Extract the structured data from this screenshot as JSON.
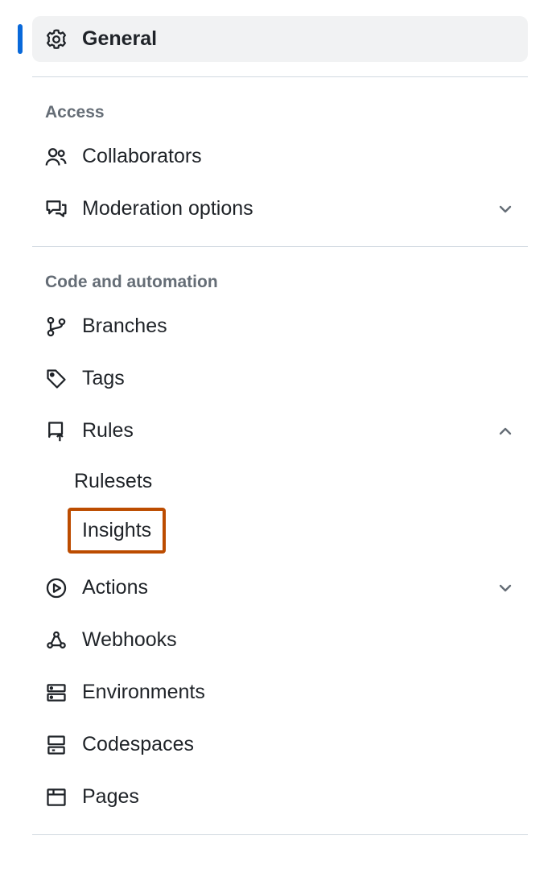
{
  "nav": {
    "general": {
      "label": "General"
    }
  },
  "sections": {
    "access": {
      "heading": "Access",
      "collaborators": {
        "label": "Collaborators"
      },
      "moderation": {
        "label": "Moderation options"
      }
    },
    "code": {
      "heading": "Code and automation",
      "branches": {
        "label": "Branches"
      },
      "tags": {
        "label": "Tags"
      },
      "rules": {
        "label": "Rules",
        "sub": {
          "rulesets": {
            "label": "Rulesets"
          },
          "insights": {
            "label": "Insights"
          }
        }
      },
      "actions": {
        "label": "Actions"
      },
      "webhooks": {
        "label": "Webhooks"
      },
      "environments": {
        "label": "Environments"
      },
      "codespaces": {
        "label": "Codespaces"
      },
      "pages": {
        "label": "Pages"
      }
    }
  },
  "colors": {
    "highlight_border": "#bc4c00",
    "active_indicator": "#0969da",
    "active_bg": "#f1f2f3",
    "heading_text": "#656d76",
    "border": "#d1d9e0"
  }
}
